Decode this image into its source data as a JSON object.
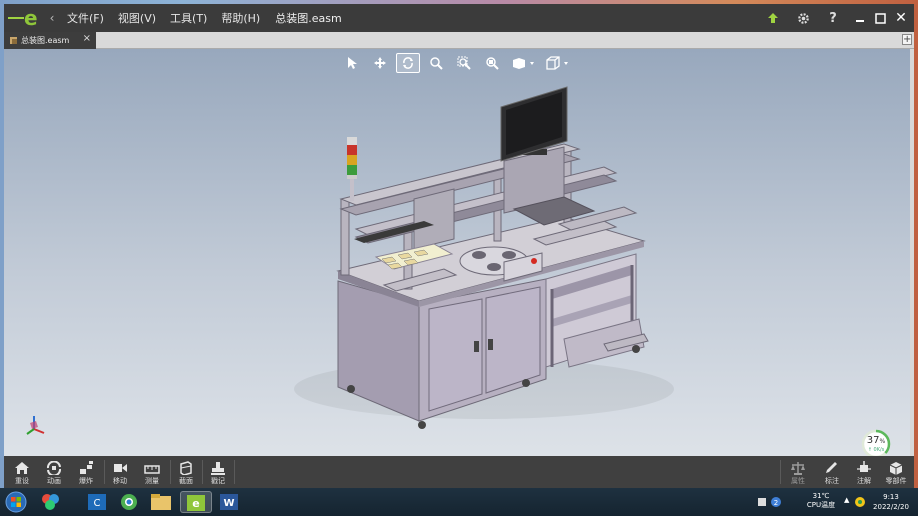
{
  "app": {
    "menus": [
      "文件(F)",
      "视图(V)",
      "工具(T)",
      "帮助(H)"
    ],
    "document_title": "总装图.easm"
  },
  "tabs": [
    {
      "label": "总装图.easm"
    }
  ],
  "viewport": {
    "toolbar_icons": [
      "select-arrow-icon",
      "pan-icon",
      "rotate-icon",
      "zoom-icon",
      "zoom-area-icon",
      "zoom-fit-icon",
      "display-style-icon",
      "view-cube-icon"
    ],
    "progress": {
      "value_text": "37",
      "unit": "%",
      "sub_text": "↑ 0K/s",
      "value": 0.37
    }
  },
  "bottom_toolbar": {
    "left": [
      {
        "label": "重设",
        "icon": "home-icon"
      },
      {
        "label": "动画",
        "icon": "animation-icon"
      },
      {
        "label": "爆炸",
        "icon": "explode-icon"
      },
      {
        "label": "移动",
        "icon": "move-icon"
      },
      {
        "label": "测量",
        "icon": "measure-icon"
      },
      {
        "label": "截面",
        "icon": "section-icon"
      },
      {
        "label": "戳记",
        "icon": "stamp-icon"
      }
    ],
    "right": [
      {
        "label": "属性",
        "icon": "scale-icon"
      },
      {
        "label": "标注",
        "icon": "pen-icon"
      },
      {
        "label": "注解",
        "icon": "annotation-icon"
      },
      {
        "label": "零部件",
        "icon": "parts-icon"
      }
    ]
  },
  "taskbar": {
    "temperature": "31℃",
    "cpu_label": "CPU温度",
    "time": "9:13",
    "date": "2022/2/20"
  },
  "colors": {
    "accent": "#8fc63a",
    "titlebar": "#3b3b3b",
    "toolbar": "#404040"
  }
}
